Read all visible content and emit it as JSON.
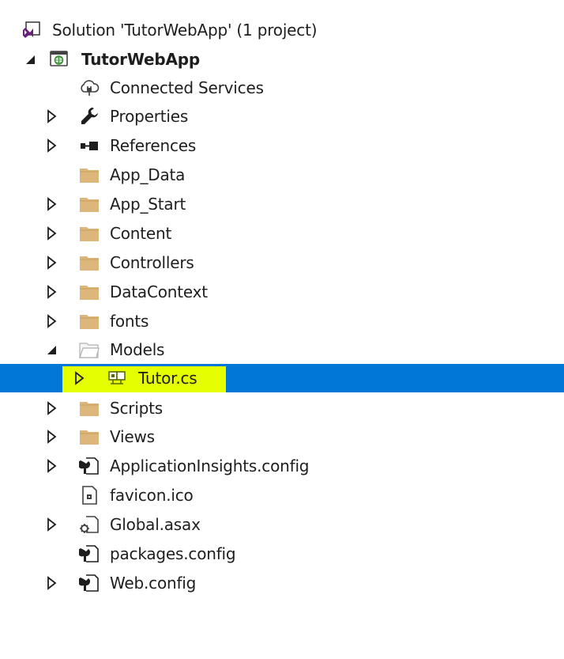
{
  "tree": {
    "solution": {
      "label": "Solution 'TutorWebApp' (1 project)"
    },
    "project": {
      "label": "TutorWebApp"
    },
    "items": [
      {
        "label": "Connected Services"
      },
      {
        "label": "Properties"
      },
      {
        "label": "References"
      },
      {
        "label": "App_Data"
      },
      {
        "label": "App_Start"
      },
      {
        "label": "Content"
      },
      {
        "label": "Controllers"
      },
      {
        "label": "DataContext"
      },
      {
        "label": "fonts"
      },
      {
        "label": "Models"
      },
      {
        "label": "Tutor.cs"
      },
      {
        "label": "Scripts"
      },
      {
        "label": "Views"
      },
      {
        "label": "ApplicationInsights.config"
      },
      {
        "label": "favicon.ico"
      },
      {
        "label": "Global.asax"
      },
      {
        "label": "packages.config"
      },
      {
        "label": "Web.config"
      }
    ]
  },
  "colors": {
    "selection": "#0078d7",
    "highlight": "#e6ff00",
    "folder": "#dcb67a",
    "solution_icon": "#68217a"
  },
  "icons": {
    "solution": "visual-studio-solution-icon",
    "project": "web-project-icon",
    "connected_services": "cloud-plug-icon",
    "properties": "wrench-icon",
    "references": "references-icon",
    "folder": "folder-icon",
    "open_folder": "folder-open-icon",
    "csharp_class": "csharp-class-icon",
    "config": "config-file-icon",
    "favicon": "icon-file-icon",
    "asax": "global-asax-icon"
  }
}
